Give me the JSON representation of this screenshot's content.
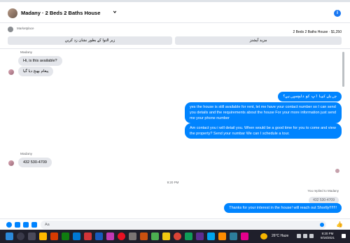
{
  "header": {
    "title": "Madany · 2 Beds 2 Baths House",
    "info_icon": "i"
  },
  "marketplace": {
    "label": "Marketplace",
    "item": "2 Beds 2 Baths House · $1,250",
    "button_left": "زیر التوا کے بطور نشان زد کریں",
    "button_right": "مزید آپشنز"
  },
  "messages": {
    "sender_name_1": "Madany",
    "in_1": "Hi, is this available?",
    "in_2": "پیغام بھیج دیا گیا",
    "out_1": "جی ہاں کیا آپ کو دلچسپی ہے؟",
    "out_2": "yes the house is still available for rent, let me have your contact number so I can send you details and the requirements about the house For  your  more  information  just  send  me  your  phone  number",
    "out_3": "Am contact you i will detail you.  When would be a good time for you to come and view the property? Send your numbar We can I schedule a tour.",
    "sender_name_2": "Madany",
    "in_3": "432 530-4709",
    "timestamp": "9:20 PM",
    "replied_label": "You replied to Madany",
    "quoted": "432 530-4709",
    "out_4": "Thanks for your interest in the house! will reach out Shortly!!!!!!!"
  },
  "composer": {
    "input_text": "Aa"
  },
  "taskbar": {
    "weather": "26°C  Haze",
    "time": "9:20 PM",
    "date": "9/18/2021"
  },
  "colors": {
    "accent": "#0084ff",
    "incoming": "#e4e6eb",
    "taskbar": "#1f1f2b"
  }
}
